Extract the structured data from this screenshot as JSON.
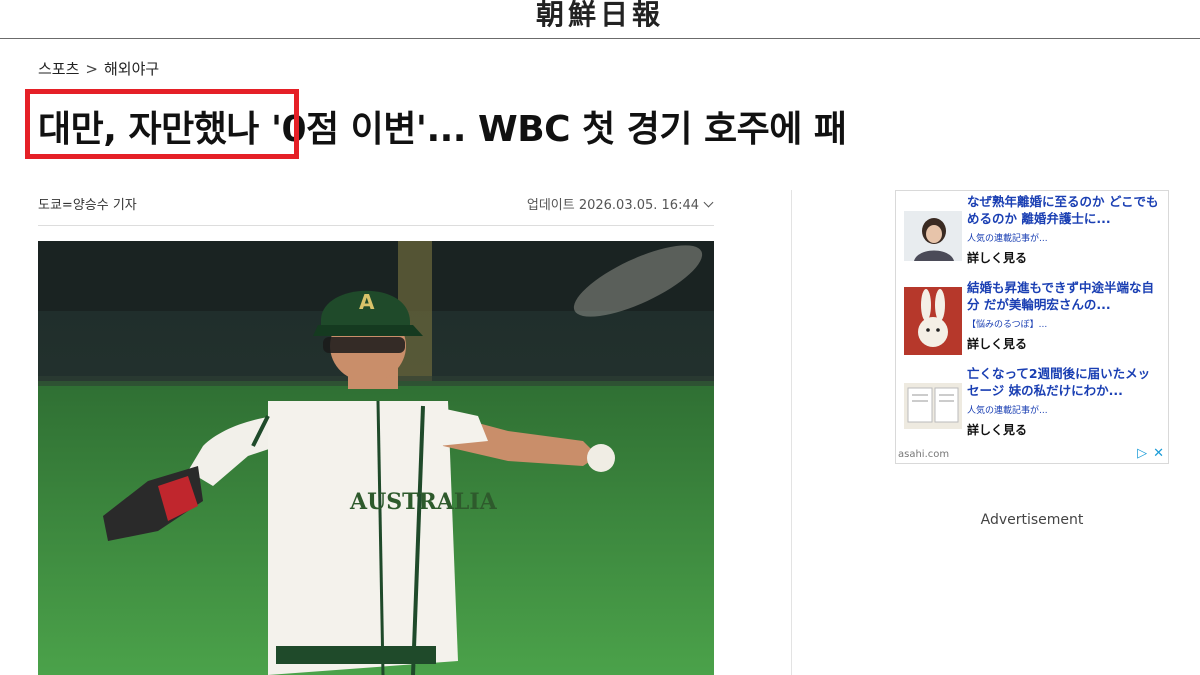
{
  "masthead": {
    "logo": "朝鮮日報"
  },
  "breadcrumb": {
    "section": "스포츠",
    "separator": ">",
    "subsection": "해외야구"
  },
  "article": {
    "headline": "대만, 자만했나 '0점 이변'... WBC 첫 경기 호주에 패",
    "byline": "도쿄=양승수 기자",
    "updated": "업데이트 2026.03.05. 16:44",
    "photo_jersey_text": "AUSTRALIA"
  },
  "highlight": {
    "color": "#e52027"
  },
  "ad": {
    "items": [
      {
        "title": "なぜ熟年離婚に至るのか どこでもめるのか 離婚弁護士に...",
        "source": "人気の連載記事が...",
        "more": "詳しく見る"
      },
      {
        "title": "結婚も昇進もできず中途半端な自分 だが美輪明宏さんの...",
        "source": "【悩みのるつぼ】...",
        "more": "詳しく見る"
      },
      {
        "title": "亡くなって2週間後に届いたメッセージ 妹の私だけにわか...",
        "source": "人気の連載記事が...",
        "more": "詳しく見る"
      }
    ],
    "footer_source": "asahi.com",
    "icons": [
      "adchoices-icon",
      "close-icon"
    ]
  },
  "advertisement_label": "Advertisement",
  "colors": {
    "ad_link": "#1a3fb3",
    "highlight": "#e52027",
    "field_green": "#3f8a3c"
  }
}
